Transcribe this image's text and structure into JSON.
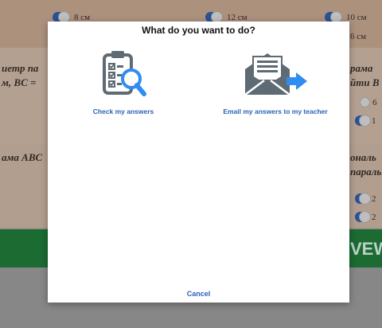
{
  "dialog": {
    "title": "What do you want to do?",
    "actions": [
      {
        "label": "Check my answers",
        "icon": "clipboard-magnifier-icon"
      },
      {
        "label": "Email my answers to my teacher",
        "icon": "envelope-arrow-icon"
      }
    ],
    "cancel_label": "Cancel"
  },
  "background": {
    "top_options": [
      "8 см",
      "12 см",
      "10 см",
      "6 см"
    ],
    "left_snippet_1": "иетр па",
    "left_snippet_2": "м, BC =",
    "left_snippet_3": "ама ABC",
    "right_snippet_1": "рама",
    "right_snippet_2": "йти B",
    "right_snippet_3": "ональ",
    "right_snippet_4": "параль",
    "right_option_1": "6",
    "right_option_2": "1",
    "right_option_3": "2",
    "right_option_4": "2",
    "green_bar_text": "VEW"
  },
  "colors": {
    "link": "#2a63b8",
    "icon_gray": "#5f6b74",
    "icon_blue": "#2f8cf2",
    "green_bar": "#1f7a3a"
  }
}
